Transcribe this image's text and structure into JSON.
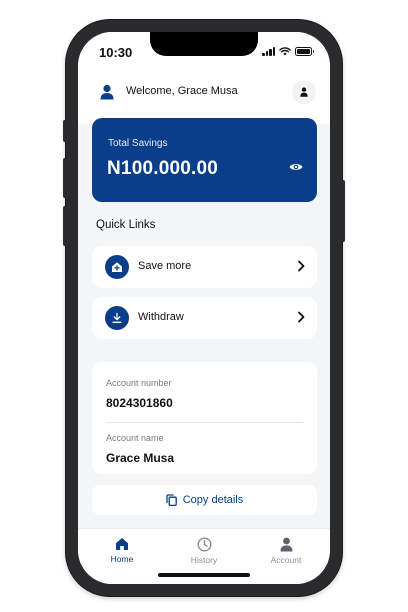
{
  "status_bar": {
    "time": "10:30"
  },
  "header": {
    "welcome_text": "Welcome, Grace Musa"
  },
  "savings": {
    "label": "Total Savings",
    "amount": "N100.000.00"
  },
  "quick_links": {
    "title": "Quick Links",
    "items": [
      {
        "label": "Save more",
        "icon": "add-home-icon"
      },
      {
        "label": "Withdraw",
        "icon": "download-icon"
      }
    ]
  },
  "account": {
    "number_label": "Account number",
    "number_value": "8024301860",
    "name_label": "Account name",
    "name_value": "Grace Musa"
  },
  "copy": {
    "label": "Copy details"
  },
  "nav": {
    "items": [
      {
        "label": "Home",
        "icon": "home-icon",
        "active": true
      },
      {
        "label": "History",
        "icon": "clock-icon",
        "active": false
      },
      {
        "label": "Account",
        "icon": "person-icon",
        "active": false
      }
    ]
  },
  "colors": {
    "primary": "#0a3d8a",
    "background": "#f4f5f7",
    "inactive": "#8a8f98"
  }
}
